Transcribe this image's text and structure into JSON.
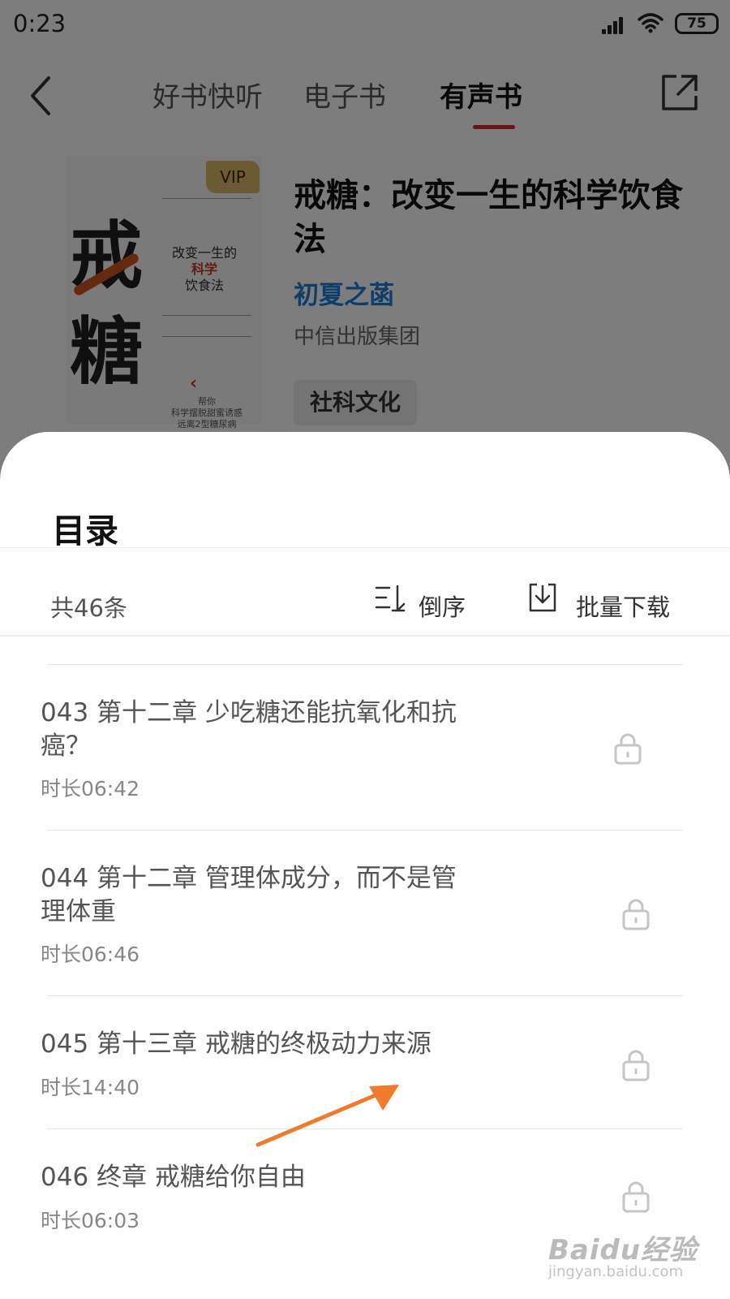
{
  "status_bar": {
    "time": "0:23",
    "battery": "75"
  },
  "nav": {
    "tabs": [
      {
        "label": "好书快听"
      },
      {
        "label": "电子书"
      },
      {
        "label": "有声书"
      }
    ],
    "active_tab": "有声书"
  },
  "book": {
    "title": "戒糖：改变一生的科学饮食法",
    "author": "初夏之菡",
    "publisher": "中信出版集团",
    "tag": "社科文化",
    "cover": {
      "vip_badge": "VIP",
      "big_char_1": "戒",
      "big_char_2": "糖",
      "subtitle_line1": "改变一生的",
      "subtitle_line2": "科学",
      "subtitle_line3": "饮食法",
      "bottom_text_1": "帮你",
      "bottom_text_2": "科学摆脱甜蜜诱惑",
      "bottom_text_3": "远离2型糖尿病"
    }
  },
  "sheet": {
    "title": "目录",
    "count": "共46条",
    "sort_label": "倒序",
    "download_label": "批量下载",
    "items": [
      {
        "title": "043 第十二章 少吃糖还能抗氧化和抗癌？",
        "duration": "时长06:42"
      },
      {
        "title": "044 第十二章 管理体成分，而不是管理体重",
        "duration": "时长06:46"
      },
      {
        "title": "045 第十三章 戒糖的终极动力来源",
        "duration": "时长14:40"
      },
      {
        "title": "046 终章 戒糖给你自由",
        "duration": "时长06:03"
      }
    ]
  },
  "watermark": {
    "main": "Baidu经验",
    "sub": "jingyan.baidu.com"
  },
  "colors": {
    "accent": "#d4262c",
    "author": "#1f7bd4",
    "arrow": "#f07b2e"
  }
}
